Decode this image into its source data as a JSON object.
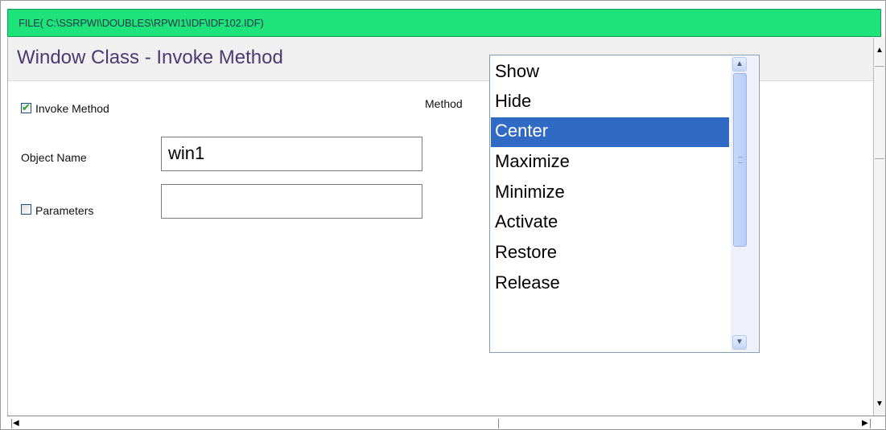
{
  "window": {
    "file_path": "FILE( C:\\SSRPWI\\DOUBLES\\RPWI1\\IDF\\IDF102.IDF)"
  },
  "panel": {
    "title": "Window Class - Invoke Method"
  },
  "form": {
    "invoke_method": {
      "label": "Invoke Method",
      "checked": true
    },
    "object_name": {
      "label": "Object Name",
      "value": "win1"
    },
    "parameters": {
      "label": "Parameters",
      "checked": false,
      "value": ""
    },
    "method": {
      "label": "Method",
      "options": [
        "Show",
        "Hide",
        "Center",
        "Maximize",
        "Minimize",
        "Activate",
        "Restore",
        "Release"
      ],
      "selected": "Center"
    }
  },
  "colors": {
    "title_bar": "#1ee27a",
    "selection": "#316ac5",
    "panel_title": "#4b3b72"
  },
  "icons": {
    "checkbox_checked": "check-icon",
    "scroll_up": "chevron-up-icon",
    "scroll_down": "chevron-down-icon",
    "scroll_left": "arrow-left-icon",
    "scroll_right": "arrow-right-icon"
  }
}
